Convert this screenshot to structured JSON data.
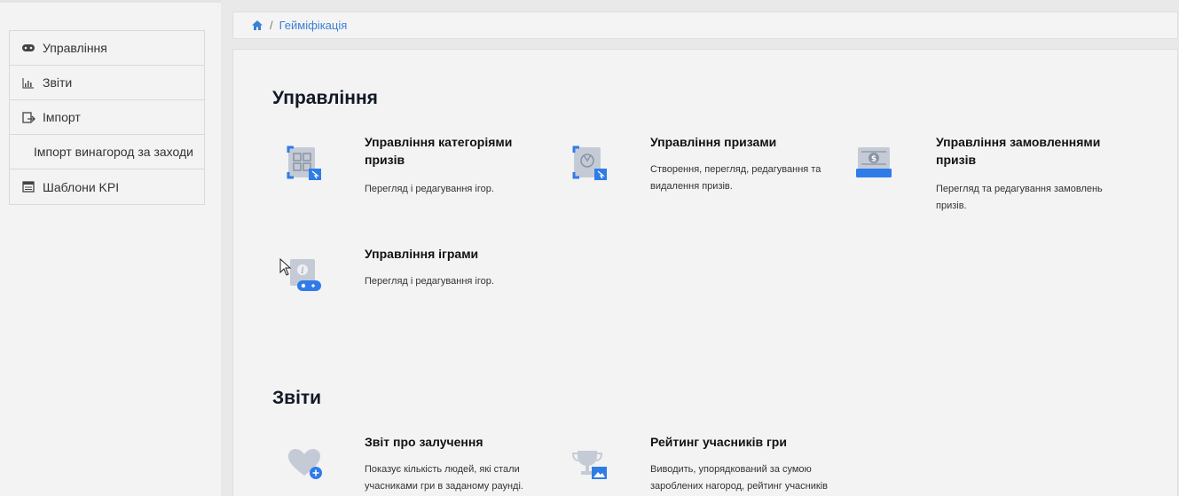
{
  "sidebar": {
    "items": [
      {
        "label": "Управління",
        "icon": "gamepad-icon"
      },
      {
        "label": "Звіти",
        "icon": "bar-chart-icon"
      },
      {
        "label": "Імпорт",
        "icon": "import-icon"
      },
      {
        "label": "Імпорт винагород за заходи",
        "icon": ""
      },
      {
        "label": "Шаблони KPI",
        "icon": "template-icon"
      }
    ]
  },
  "breadcrumb": {
    "home_icon": "home-icon",
    "separator": "/",
    "current": "Гейміфікація"
  },
  "sections": {
    "management": {
      "title": "Управління",
      "cards": [
        {
          "title": "Управління категоріями призів",
          "desc": "Перегляд і редагування ігор.",
          "icon": "category-grid-icon"
        },
        {
          "title": "Управління призами",
          "desc": "Створення, перегляд, редагування та видалення призів.",
          "icon": "prize-icon"
        },
        {
          "title": "Управління замовленнями призів",
          "desc": "Перегляд та редагування замовлень призів.",
          "icon": "money-order-icon"
        },
        {
          "title": "Управління іграми",
          "desc": "Перегляд і редагування ігор.",
          "icon": "game-info-icon"
        }
      ]
    },
    "reports": {
      "title": "Звіти",
      "cards": [
        {
          "title": "Звіт про залучення",
          "desc": "Показує кількість людей, які стали учасниками гри в заданому раунді.",
          "icon": "heart-plus-icon"
        },
        {
          "title": "Рейтинг учасників гри",
          "desc": "Виводить, упорядкований за сумою зароблених нагород, рейтинг учасників",
          "icon": "trophy-icon"
        }
      ]
    }
  },
  "colors": {
    "accent": "#3b7fd6",
    "icon_blue": "#2f7ce8",
    "icon_gray": "#c5cbd6"
  }
}
